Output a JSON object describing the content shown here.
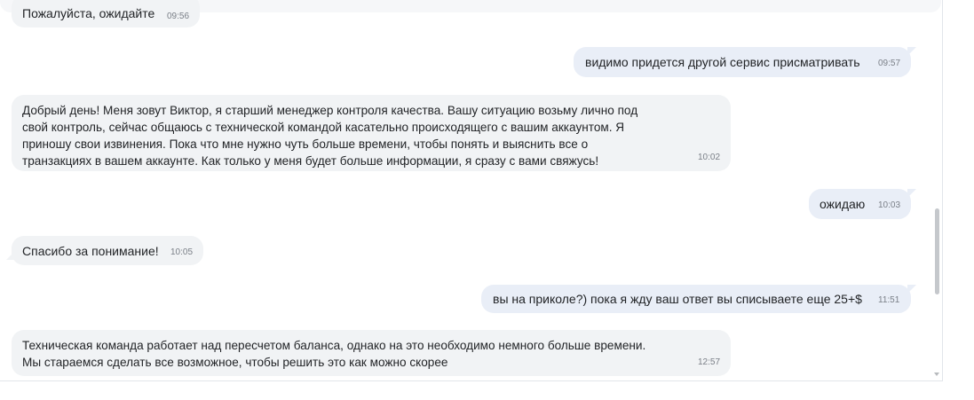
{
  "messages": [
    {
      "direction": "incoming",
      "text": "Пожалуйста, ожидайте",
      "time": "09:56"
    },
    {
      "direction": "outgoing",
      "text": "видимо придется другой сервис присматривать",
      "time": "09:57"
    },
    {
      "direction": "incoming",
      "text": "Добрый день! Меня зовут Виктор, я старший менеджер контроля качества. Вашу ситуацию возьму лично под\nсвой контроль, сейчас общаюсь с технической командой касательно происходящего с вашим аккаунтом. Я\nприношу свои извинения. Пока что мне нужно чуть больше времени, чтобы понять и выяснить все о\nтранзакциях в вашем аккаунте. Как только у меня будет больше информации, я сразу с вами свяжусь!",
      "time": "10:02"
    },
    {
      "direction": "outgoing",
      "text": "ожидаю",
      "time": "10:03"
    },
    {
      "direction": "incoming",
      "text": "Спасибо за понимание!",
      "time": "10:05"
    },
    {
      "direction": "outgoing",
      "text": "вы на приколе?) пока я жду ваш ответ вы списываете еще 25+$",
      "time": "11:51"
    },
    {
      "direction": "incoming",
      "text": "Техническая команда работает над пересчетом баланса, однако на это необходимо немного больше времени.\nМы стараемся сделать все возможное, чтобы решить это как можно скорее",
      "time": "12:57"
    }
  ]
}
